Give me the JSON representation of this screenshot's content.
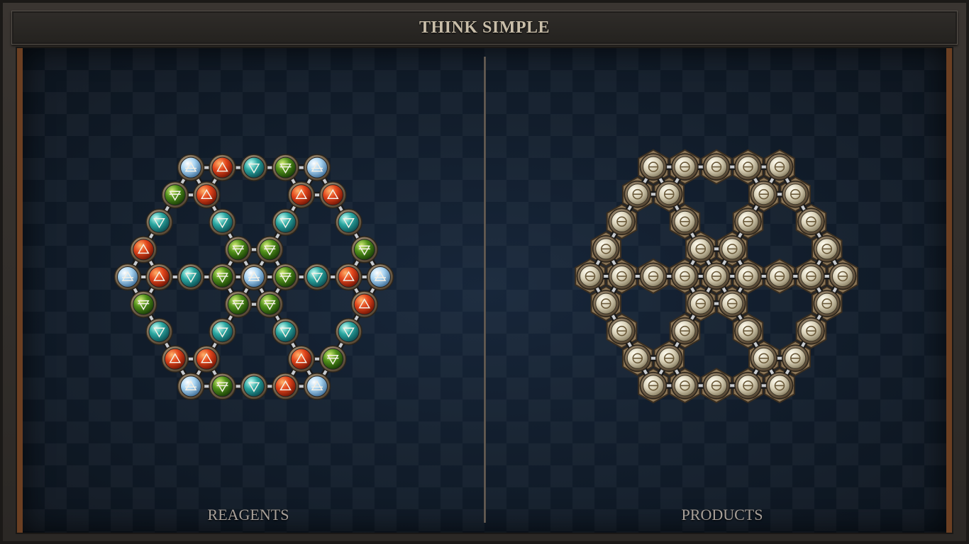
{
  "title": "THINK SIMPLE",
  "reagents_label": "REAGENTS",
  "products_label": "PRODUCTS",
  "colors": {
    "air": "#a8d4f2",
    "fire": "#e2451c",
    "water": "#2aa6a0",
    "earth": "#4f8f1a",
    "salt": "#d9d1b8",
    "frame": "#6b3f22",
    "background": "#0f1a24"
  },
  "element_glyphs": {
    "air": "air-symbol",
    "fire": "fire-symbol",
    "water": "water-symbol",
    "earth": "earth-symbol",
    "salt": "salt-symbol"
  },
  "reagents_atoms": [
    [
      "air",
      0,
      -4
    ],
    [
      "fire",
      1,
      -4
    ],
    [
      "water",
      2,
      -4
    ],
    [
      "earth",
      3,
      -4
    ],
    [
      "air",
      4,
      -4
    ],
    [
      "earth",
      -1,
      -3
    ],
    [
      "fire",
      0,
      -3
    ],
    [
      "fire",
      3,
      -3
    ],
    [
      "fire",
      4,
      -3
    ],
    [
      "water",
      -2,
      -2
    ],
    [
      "water",
      0,
      -2
    ],
    [
      "water",
      2,
      -2
    ],
    [
      "water",
      4,
      -2
    ],
    [
      "fire",
      -3,
      -1
    ],
    [
      "earth",
      0,
      -1
    ],
    [
      "earth",
      1,
      -1
    ],
    [
      "earth",
      4,
      -1
    ],
    [
      "air",
      -4,
      0
    ],
    [
      "fire",
      -3,
      0
    ],
    [
      "water",
      -2,
      0
    ],
    [
      "earth",
      -1,
      0
    ],
    [
      "air",
      0,
      0
    ],
    [
      "earth",
      1,
      0
    ],
    [
      "water",
      2,
      0
    ],
    [
      "fire",
      3,
      0
    ],
    [
      "air",
      4,
      0
    ],
    [
      "earth",
      -4,
      1
    ],
    [
      "earth",
      -1,
      1
    ],
    [
      "earth",
      0,
      1
    ],
    [
      "fire",
      3,
      1
    ],
    [
      "water",
      -4,
      2
    ],
    [
      "water",
      -2,
      2
    ],
    [
      "water",
      0,
      2
    ],
    [
      "water",
      2,
      2
    ],
    [
      "fire",
      -4,
      3
    ],
    [
      "fire",
      -3,
      3
    ],
    [
      "fire",
      0,
      3
    ],
    [
      "earth",
      1,
      3
    ],
    [
      "air",
      -4,
      4
    ],
    [
      "earth",
      -3,
      4
    ],
    [
      "water",
      -2,
      4
    ],
    [
      "fire",
      -1,
      4
    ],
    [
      "air",
      0,
      4
    ]
  ],
  "products_atoms": [
    [
      0,
      -4
    ],
    [
      1,
      -4
    ],
    [
      2,
      -4
    ],
    [
      3,
      -4
    ],
    [
      4,
      -4
    ],
    [
      -1,
      -3
    ],
    [
      0,
      -3
    ],
    [
      3,
      -3
    ],
    [
      4,
      -3
    ],
    [
      -2,
      -2
    ],
    [
      0,
      -2
    ],
    [
      2,
      -2
    ],
    [
      4,
      -2
    ],
    [
      -3,
      -1
    ],
    [
      0,
      -1
    ],
    [
      1,
      -1
    ],
    [
      4,
      -1
    ],
    [
      -4,
      0
    ],
    [
      -3,
      0
    ],
    [
      -2,
      0
    ],
    [
      -1,
      0
    ],
    [
      0,
      0
    ],
    [
      1,
      0
    ],
    [
      2,
      0
    ],
    [
      3,
      0
    ],
    [
      4,
      0
    ],
    [
      -4,
      1
    ],
    [
      -1,
      1
    ],
    [
      0,
      1
    ],
    [
      3,
      1
    ],
    [
      -4,
      2
    ],
    [
      -2,
      2
    ],
    [
      0,
      2
    ],
    [
      2,
      2
    ],
    [
      -4,
      3
    ],
    [
      -3,
      3
    ],
    [
      0,
      3
    ],
    [
      1,
      3
    ],
    [
      -4,
      4
    ],
    [
      -3,
      4
    ],
    [
      -2,
      4
    ],
    [
      -1,
      4
    ],
    [
      0,
      4
    ]
  ]
}
